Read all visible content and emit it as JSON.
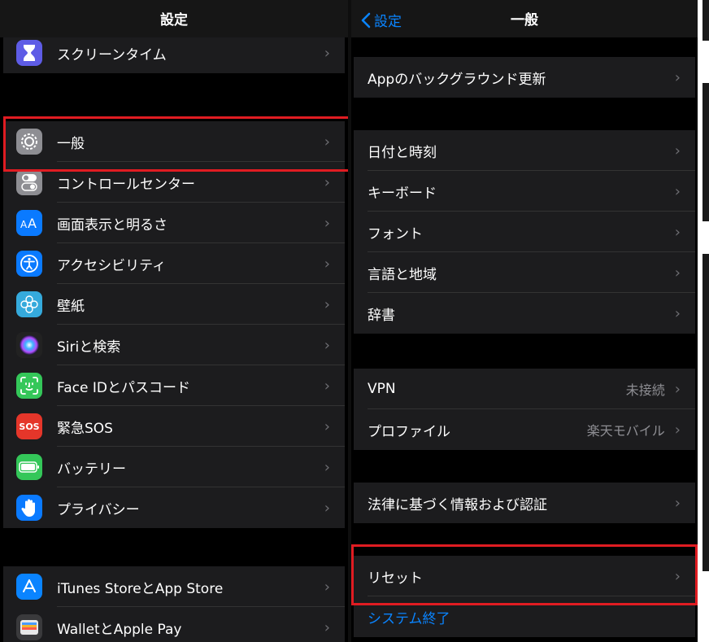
{
  "left": {
    "title": "設定",
    "group1": [
      {
        "label": "スクリーンタイム",
        "icon": "hourglass-icon",
        "color": "#5e5ce6"
      }
    ],
    "group2": [
      {
        "label": "一般",
        "icon": "gear-icon",
        "color": "#8e8e93"
      },
      {
        "label": "コントロールセンター",
        "icon": "toggles-icon",
        "color": "#8e8e93"
      },
      {
        "label": "画面表示と明るさ",
        "icon": "text-size-icon",
        "color": "#0a7aff"
      },
      {
        "label": "アクセシビリティ",
        "icon": "accessibility-icon",
        "color": "#0a7aff"
      },
      {
        "label": "壁紙",
        "icon": "flower-icon",
        "color": "#35aadc"
      },
      {
        "label": "Siriと検索",
        "icon": "siri-icon",
        "color": "#222222"
      },
      {
        "label": "Face IDとパスコード",
        "icon": "face-id-icon",
        "color": "#34c759"
      },
      {
        "label": "緊急SOS",
        "icon": "sos-icon",
        "color": "#e5362a",
        "icon_text": "SOS"
      },
      {
        "label": "バッテリー",
        "icon": "battery-icon",
        "color": "#34c759"
      },
      {
        "label": "プライバシー",
        "icon": "hand-icon",
        "color": "#0a7aff"
      }
    ],
    "group3": [
      {
        "label": "iTunes StoreとApp Store",
        "icon": "app-store-icon",
        "color": "#0a84ff"
      },
      {
        "label": "WalletとApple Pay",
        "icon": "wallet-icon",
        "color": "#3a3a3c"
      }
    ]
  },
  "right": {
    "title": "一般",
    "back_label": "設定",
    "group1": [
      {
        "label": "Appのバックグラウンド更新"
      }
    ],
    "group2": [
      {
        "label": "日付と時刻"
      },
      {
        "label": "キーボード"
      },
      {
        "label": "フォント"
      },
      {
        "label": "言語と地域"
      },
      {
        "label": "辞書"
      }
    ],
    "group3": [
      {
        "label": "VPN",
        "detail": "未接続"
      },
      {
        "label": "プロファイル",
        "detail": "楽天モバイル"
      }
    ],
    "group4": [
      {
        "label": "法律に基づく情報および認証"
      }
    ],
    "group5": [
      {
        "label": "リセット"
      },
      {
        "label": "システム終了"
      }
    ]
  },
  "highlight_color": "#e01c22"
}
